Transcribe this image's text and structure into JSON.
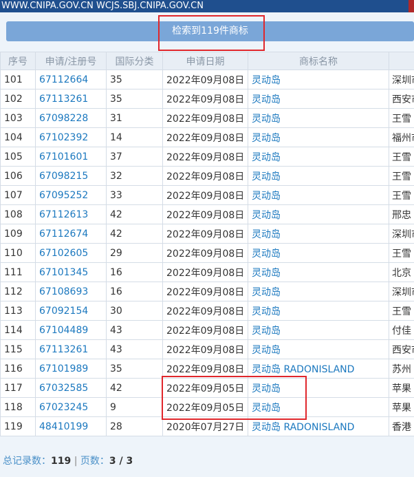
{
  "header": {
    "url_text": "WWW.CNIPA.GOV.CN WCJS.SBJ.CNIPA.GOV.CN"
  },
  "search": {
    "result_label": "检索到119件商标"
  },
  "table": {
    "columns": [
      "序号",
      "申请/注册号",
      "国际分类",
      "申请日期",
      "商标名称",
      ""
    ],
    "rows": [
      [
        "101",
        "67112664",
        "35",
        "2022年09月08日",
        "灵动岛",
        "深圳市"
      ],
      [
        "102",
        "67113261",
        "35",
        "2022年09月08日",
        "灵动岛",
        "西安市"
      ],
      [
        "103",
        "67098228",
        "31",
        "2022年09月08日",
        "灵动岛",
        "王雪"
      ],
      [
        "104",
        "67102392",
        "14",
        "2022年09月08日",
        "灵动岛",
        "福州市"
      ],
      [
        "105",
        "67101601",
        "37",
        "2022年09月08日",
        "灵动岛",
        "王雪"
      ],
      [
        "106",
        "67098215",
        "32",
        "2022年09月08日",
        "灵动岛",
        "王雪"
      ],
      [
        "107",
        "67095252",
        "33",
        "2022年09月08日",
        "灵动岛",
        "王雪"
      ],
      [
        "108",
        "67112613",
        "42",
        "2022年09月08日",
        "灵动岛",
        "邢忠"
      ],
      [
        "109",
        "67112674",
        "42",
        "2022年09月08日",
        "灵动岛",
        "深圳市"
      ],
      [
        "110",
        "67102605",
        "29",
        "2022年09月08日",
        "灵动岛",
        "王雪"
      ],
      [
        "111",
        "67101345",
        "16",
        "2022年09月08日",
        "灵动岛",
        "北京"
      ],
      [
        "112",
        "67108693",
        "16",
        "2022年09月08日",
        "灵动岛",
        "深圳市"
      ],
      [
        "113",
        "67092154",
        "30",
        "2022年09月08日",
        "灵动岛",
        "王雪"
      ],
      [
        "114",
        "67104489",
        "43",
        "2022年09月08日",
        "灵动岛",
        "付佳"
      ],
      [
        "115",
        "67113261",
        "43",
        "2022年09月08日",
        "灵动岛",
        "西安市"
      ],
      [
        "116",
        "67101989",
        "35",
        "2022年09月08日",
        "灵动岛 RADONISLAND",
        "苏州"
      ],
      [
        "117",
        "67032585",
        "42",
        "2022年09月05日",
        "灵动岛",
        "苹果"
      ],
      [
        "118",
        "67023245",
        "9",
        "2022年09月05日",
        "灵动岛",
        "苹果"
      ],
      [
        "119",
        "48410199",
        "28",
        "2020年07月27日",
        "灵动岛 RADONISLAND",
        "香港"
      ]
    ]
  },
  "footer": {
    "total_label": "总记录数：",
    "total": "119",
    "sep": "|",
    "pages_label": "页数：",
    "pages": "3 / 3"
  }
}
